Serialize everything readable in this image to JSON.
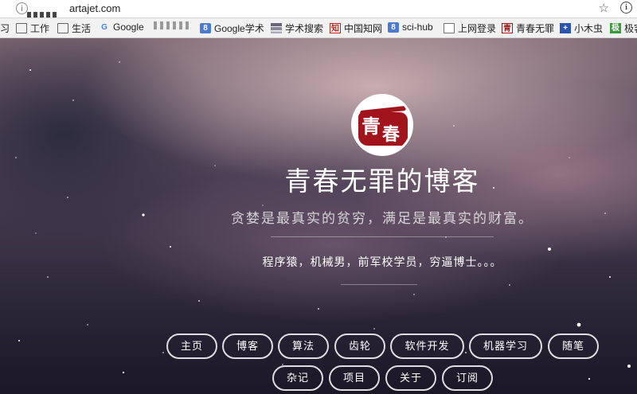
{
  "browser": {
    "url": "artajet.com",
    "bookmarks": [
      {
        "label": "习",
        "icon": "none"
      },
      {
        "label": "工作",
        "icon": "folder-icon"
      },
      {
        "label": "生活",
        "icon": "folder-icon"
      },
      {
        "label": "Google",
        "icon": "google-icon"
      },
      {
        "label": "",
        "icon": "pixelated-icon"
      },
      {
        "label": "Google学术",
        "icon": "scholar-icon"
      },
      {
        "label": "学术搜索",
        "icon": "stack-icon"
      },
      {
        "label": "中国知网",
        "icon": "cnki-icon"
      },
      {
        "label": "sci-hub",
        "icon": "scihub-icon"
      },
      {
        "label": "上网登录",
        "icon": "document-icon"
      },
      {
        "label": "青春无罪",
        "icon": "qingchun-icon"
      },
      {
        "label": "小木虫",
        "icon": "muchong-icon"
      },
      {
        "label": "极客",
        "icon": "jike-icon"
      }
    ]
  },
  "hero": {
    "avatar_chars": [
      "青",
      "春"
    ],
    "title": "青春无罪的博客",
    "subtitle": "贪婪是最真实的贫穷，满足是最真实的财富。",
    "description": "程序猿，机械男，前军校学员，穷逼博士。。。"
  },
  "nav": {
    "row1": [
      "主页",
      "博客",
      "算法",
      "齿轮",
      "软件开发",
      "机器学习",
      "随笔"
    ],
    "row2": [
      "杂记",
      "项目",
      "关于",
      "订阅"
    ]
  },
  "colors": {
    "avatar_red": "#a2141c",
    "sky_top": "#7d6772",
    "sky_bottom": "#1b1726"
  }
}
